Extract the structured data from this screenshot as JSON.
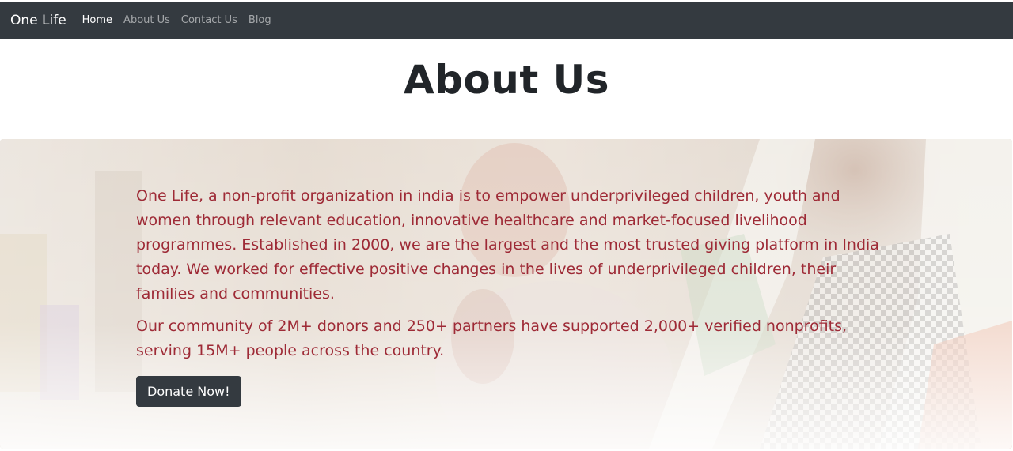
{
  "navbar": {
    "brand": "One Life",
    "links": [
      {
        "label": "Home",
        "active": true
      },
      {
        "label": "About Us",
        "active": false
      },
      {
        "label": "Contact Us",
        "active": false
      },
      {
        "label": "Blog",
        "active": false
      }
    ]
  },
  "main": {
    "title": "About Us",
    "hero": {
      "paragraphs": [
        "One Life, a non-profit organization in india is to empower underprivileged children, youth and women through relevant education, innovative healthcare and market-focused livelihood programmes. Established in 2000, we are the largest and the most trusted giving platform in India today. We worked for effective positive changes in the lives of underprivileged children, their families and communities.",
        "Our community of 2M+ donors and 250+ partners have supported 2,000+ verified nonprofits, serving 15M+ people across the country."
      ],
      "button_label": "Donate Now!"
    }
  },
  "colors": {
    "navbar_bg": "#343a40",
    "hero_text": "#9e2a36",
    "button_bg": "#343a40"
  }
}
